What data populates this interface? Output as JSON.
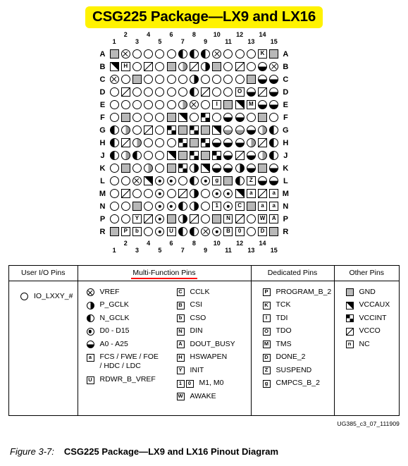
{
  "title": "CSG225 Package—LX9 and LX16",
  "doc_id": "UG385_c3_07_111909",
  "caption": {
    "number": "Figure 3-7:",
    "text": "CSG225 Package—LX9 and LX16 Pinout Diagram"
  },
  "grid": {
    "columns": [
      "1",
      "2",
      "3",
      "4",
      "5",
      "6",
      "7",
      "8",
      "9",
      "10",
      "11",
      "12",
      "13",
      "14",
      "15"
    ],
    "rows": [
      "A",
      "B",
      "C",
      "D",
      "E",
      "F",
      "G",
      "H",
      "J",
      "K",
      "L",
      "M",
      "N",
      "P",
      "R"
    ],
    "cells": [
      [
        "gnd",
        "vref",
        "empty",
        "empty",
        "empty",
        "empty",
        "ngclk",
        "ngclk",
        "ngclk",
        "vref",
        "empty",
        "empty",
        "empty",
        "box:K",
        "gnd"
      ],
      [
        "vccaux",
        "box:H",
        "empty",
        "vcco",
        "empty",
        "gnd",
        "pgclkg",
        "vcco",
        "pgclk",
        "gnd",
        "empty",
        "vcco",
        "empty",
        "addr",
        "vref"
      ],
      [
        "vref",
        "empty",
        "gnd",
        "empty",
        "empty",
        "empty",
        "empty",
        "pgclk",
        "empty",
        "empty",
        "empty",
        "empty",
        "gnd",
        "addr",
        "addr"
      ],
      [
        "empty",
        "vcco",
        "empty",
        "empty",
        "empty",
        "empty",
        "empty",
        "ngclk",
        "vcco",
        "empty",
        "empty",
        "box:O",
        "addr",
        "vcco",
        "addr"
      ],
      [
        "empty",
        "empty",
        "empty",
        "empty",
        "empty",
        "empty",
        "pgclkg",
        "vref",
        "empty",
        "box:I",
        "gnd",
        "vccaux",
        "box:M",
        "addr",
        "addr"
      ],
      [
        "empty",
        "gnd",
        "empty",
        "empty",
        "empty",
        "gnd",
        "vccaux",
        "empty",
        "vccint",
        "empty",
        "addr",
        "addr",
        "empty",
        "gnd",
        "empty"
      ],
      [
        "ngclk",
        "pgclkg",
        "empty",
        "vcco",
        "empty",
        "vccint",
        "gnd",
        "vccint",
        "gnd",
        "vccaux",
        "addrg",
        "addrg",
        "addr",
        "pgclkg",
        "ngclk"
      ],
      [
        "ngclk",
        "vcco",
        "pgclkg",
        "empty",
        "empty",
        "empty",
        "vccint",
        "gnd",
        "vccint",
        "addr",
        "addr",
        "addr",
        "pgclkg",
        "vcco",
        "ngclk"
      ],
      [
        "ngclk",
        "pgclkg",
        "ngclk",
        "empty",
        "empty",
        "vccaux",
        "gnd",
        "vccint",
        "gnd",
        "vccint",
        "addr",
        "vcco",
        "addr",
        "pgclkg",
        "ngclk"
      ],
      [
        "empty",
        "gnd",
        "empty",
        "pgclkg",
        "empty",
        "gnd",
        "vccint",
        "pgclk",
        "vccaux",
        "addr",
        "addr",
        "pgclk",
        "addr",
        "gnd",
        "addr"
      ],
      [
        "empty",
        "empty",
        "vref",
        "vccaux",
        "data",
        "data",
        "empty",
        "ngclk",
        "data",
        "box:g",
        "gnd",
        "ngclk",
        "box:Z",
        "addr",
        "addr"
      ],
      [
        "empty",
        "vcco",
        "empty",
        "empty",
        "data",
        "empty",
        "vcco",
        "pgclk",
        "empty",
        "data",
        "data",
        "vccaux",
        "box:a",
        "vcco",
        "box:a"
      ],
      [
        "empty",
        "empty",
        "gnd",
        "empty",
        "data",
        "data",
        "ngclk",
        "pgclk",
        "empty",
        "box:1",
        "data",
        "box:C",
        "gnd",
        "box:a",
        "box:a"
      ],
      [
        "empty",
        "empty",
        "box:Y",
        "vcco",
        "data",
        "gnd",
        "pgclk",
        "vcco",
        "empty",
        "gnd",
        "box:N",
        "vcco",
        "empty",
        "box:W",
        "box:A"
      ],
      [
        "gnd",
        "box:P",
        "box:b",
        "empty",
        "data",
        "box:U",
        "ngclk",
        "ngclk",
        "vref",
        "data",
        "box:B",
        "box:0",
        "empty",
        "box:D",
        "gnd"
      ]
    ]
  },
  "legend": {
    "headers": {
      "user_io": "User I/O Pins",
      "multi_function": "Multi-Function Pins",
      "dedicated": "Dedicated Pins",
      "other": "Other Pins"
    },
    "user_io_items": [
      {
        "symbol": "empty",
        "label": "IO_LXXY_#"
      }
    ],
    "multi_function_col1": [
      {
        "symbol": "vref",
        "label": "VREF"
      },
      {
        "symbol": "pgclk",
        "label": "P_GCLK"
      },
      {
        "symbol": "ngclk",
        "label": "N_GCLK"
      },
      {
        "symbol": "data",
        "label": "D0 - D15"
      },
      {
        "symbol": "addr",
        "label": "A0 - A25"
      },
      {
        "symbol": "box:a",
        "label": "FCS / FWE / FOE / HDC / LDC"
      },
      {
        "symbol": "box:U",
        "label": "RDWR_B_VREF"
      }
    ],
    "multi_function_col2": [
      {
        "symbol": "box:C",
        "label": "CCLK"
      },
      {
        "symbol": "box:B",
        "label": "CSI"
      },
      {
        "symbol": "box:b",
        "label": "CSO"
      },
      {
        "symbol": "box:N",
        "label": "DIN"
      },
      {
        "symbol": "box:A",
        "label": "DOUT_BUSY"
      },
      {
        "symbol": "box:H",
        "label": "HSWAPEN"
      },
      {
        "symbol": "box:Y",
        "label": "INIT"
      },
      {
        "symbol": "box:0",
        "label": "M1, M0"
      },
      {
        "symbol": "box:W",
        "label": "AWAKE"
      }
    ],
    "dedicated_items": [
      {
        "symbol": "box:P",
        "label": "PROGRAM_B_2"
      },
      {
        "symbol": "box:K",
        "label": "TCK"
      },
      {
        "symbol": "box:I",
        "label": "TDI"
      },
      {
        "symbol": "box:O",
        "label": "TDO"
      },
      {
        "symbol": "box:M",
        "label": "TMS"
      },
      {
        "symbol": "box:D",
        "label": "DONE_2"
      },
      {
        "symbol": "box:Z",
        "label": "SUSPEND"
      },
      {
        "symbol": "box:g",
        "label": "CMPCS_B_2"
      }
    ],
    "other_items": [
      {
        "symbol": "gnd",
        "label": "GND"
      },
      {
        "symbol": "vccaux",
        "label": "VCCAUX"
      },
      {
        "symbol": "vccint",
        "label": "VCCINT"
      },
      {
        "symbol": "vcco",
        "label": "VCCO"
      },
      {
        "symbol": "box:n",
        "label": "NC"
      }
    ]
  },
  "colors": {
    "title_highlight": "#FFF200",
    "underline_accent": "#ff0000",
    "gnd_fill": "#b8b8b8",
    "gray_half": "#9a9a9a"
  }
}
